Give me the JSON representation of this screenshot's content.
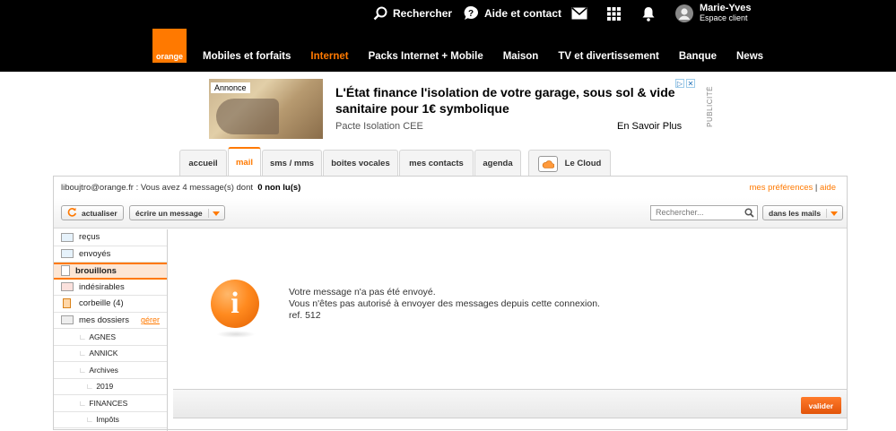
{
  "header": {
    "search_label": "Rechercher",
    "help_label": "Aide et contact",
    "user_name": "Marie-Yves",
    "user_space": "Espace client",
    "logo_text": "orange",
    "nav": [
      "Mobiles et forfaits",
      "Internet",
      "Packs Internet + Mobile",
      "Maison",
      "TV et divertissement",
      "Banque",
      "News"
    ],
    "nav_active": "Internet"
  },
  "ad": {
    "badge": "Annonce",
    "title": "L'État finance l'isolation de votre garage, sous sol & vide sanitaire pour 1€ symbolique",
    "subtitle": "Pacte Isolation CEE",
    "cta": "En Savoir Plus",
    "vertical_label": "PUBLICITÉ"
  },
  "tabs": {
    "items": [
      "accueil",
      "mail",
      "sms / mms",
      "boites vocales",
      "mes contacts",
      "agenda"
    ],
    "active": "mail",
    "cloud": "Le Cloud"
  },
  "mail": {
    "info_prefix": "liboujtro@orange.fr : Vous avez 4 message(s) dont",
    "info_unread": "0 non lu(s)",
    "prefs": "mes préférences",
    "prefs_sep": "|",
    "help": "aide",
    "refresh": "actualiser",
    "write": "écrire un message",
    "search_placeholder": "Rechercher...",
    "search_scope": "dans les mails",
    "valider": "valider"
  },
  "sidebar": {
    "items": [
      {
        "label": "reçus",
        "icon": "inbox-icon"
      },
      {
        "label": "envoyés",
        "icon": "sent-icon"
      },
      {
        "label": "brouillons",
        "icon": "drafts-icon"
      },
      {
        "label": "indésirables",
        "icon": "spam-icon"
      },
      {
        "label": "corbeille (4)",
        "icon": "trash-icon"
      },
      {
        "label": "mes dossiers",
        "icon": "folder-icon"
      }
    ],
    "active": "brouillons",
    "manage": "gérer",
    "folders": [
      {
        "label": "AGNES",
        "level": 1
      },
      {
        "label": "ANNICK",
        "level": 1
      },
      {
        "label": "Archives",
        "level": 1
      },
      {
        "label": "2019",
        "level": 2
      },
      {
        "label": "FINANCES",
        "level": 1
      },
      {
        "label": "Impôts",
        "level": 2
      }
    ]
  },
  "message": {
    "line1": "Votre message n'a pas été envoyé.",
    "line2": "Vous n'êtes pas autorisé à envoyer des messages depuis cette connexion.",
    "line3": "ref. 512",
    "icon_glyph": "i"
  },
  "colors": {
    "brand": "#ff7900",
    "topbar": "#000000"
  }
}
